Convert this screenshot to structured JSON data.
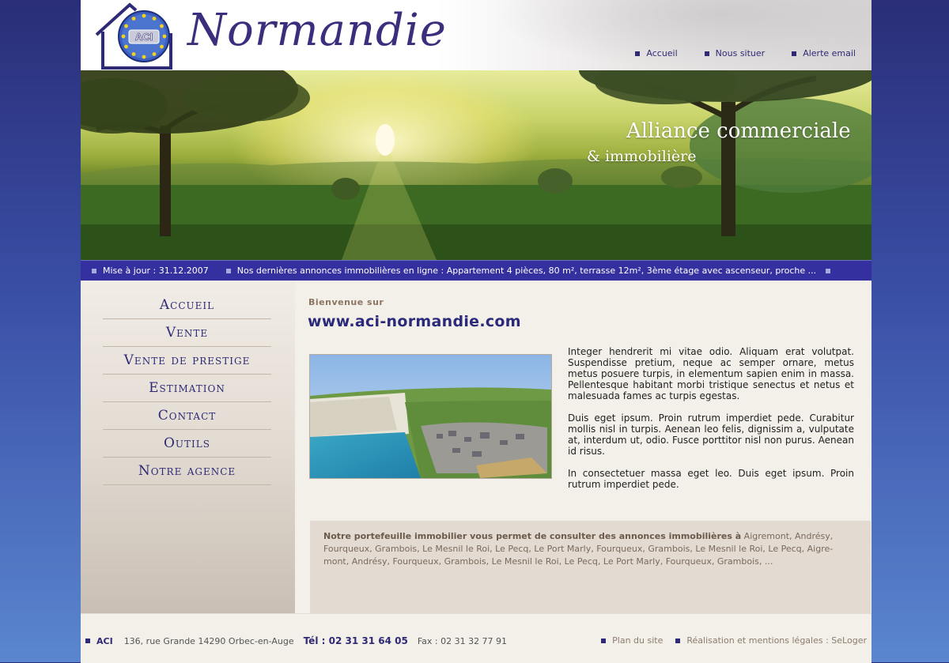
{
  "header": {
    "logo_text": "ACI",
    "site_title": "Normandie",
    "nav": [
      {
        "label": "Accueil"
      },
      {
        "label": "Nous situer"
      },
      {
        "label": "Alerte email"
      }
    ]
  },
  "banner": {
    "title": "Alliance commerciale",
    "subtitle": "& immobilière"
  },
  "ticker": {
    "updated": "Mise à jour : 31.12.2007",
    "news": "Nos dernières annonces immobilières en ligne : Appartement 4 pièces, 80 m², terrasse 12m², 3ème étage avec ascenseur, proche ..."
  },
  "sidebar": {
    "menu": [
      {
        "label": "Accueil"
      },
      {
        "label": "Vente"
      },
      {
        "label": "Vente de prestige"
      },
      {
        "label": "Estimation"
      },
      {
        "label": "Contact"
      },
      {
        "label": "Outils"
      },
      {
        "label": "Notre agence"
      }
    ]
  },
  "main": {
    "welcome": "Bienvenue sur",
    "url": "www.aci-normandie.com",
    "paragraphs": [
      "Integer hendrerit mi vitae odio. Aliquam erat volutpat. Suspendisse pretium, neque ac semper ornare, metus metus posuere turpis, in elementum sapien enim in massa. Pellentesque habitant morbi tristique senectus et netus et malesuada fames ac turpis egestas.",
      "Duis eget ipsum. Proin rutrum imperdiet pede. Curabitur mollis nisl in turpis. Aenean leo felis, dignissim a, vulputate at, interdum ut, odio. Fusce porttitor nisl non purus. Aenean id risus.",
      "In consectetuer massa eget leo. Duis eget ipsum. Proin rutrum imperdiet pede."
    ],
    "portfolio_lead": "Notre portefeuille immobilier vous permet de consulter des annonces immobilières à",
    "portfolio_text": "Aigremont, Andrésy, Fourqueux, Grambois, Le Mesnil le Roi, Le Pecq, Le Port Marly, Fourqueux, Grambois, Le Mesnil le Roi, Le Pecq, Aigre-mont, Andrésy, Fourqueux, Grambois, Le Mesnil le Roi, Le Pecq, Le Port Marly, Fourqueux, Grambois, ..."
  },
  "footer": {
    "brand": "ACI",
    "address": "136, rue Grande 14290 Orbec-en-Auge",
    "tel": "Tél : 02 31 31 64 05",
    "fax": "Fax : 02 31 32 77 91",
    "links": [
      {
        "label": "Plan du site"
      },
      {
        "label": "Réalisation et mentions légales : SeLoger"
      }
    ]
  },
  "colors": {
    "accent": "#2e2a76",
    "ticker_bg": "#3530a0",
    "page_bg": "#f3efe9"
  }
}
